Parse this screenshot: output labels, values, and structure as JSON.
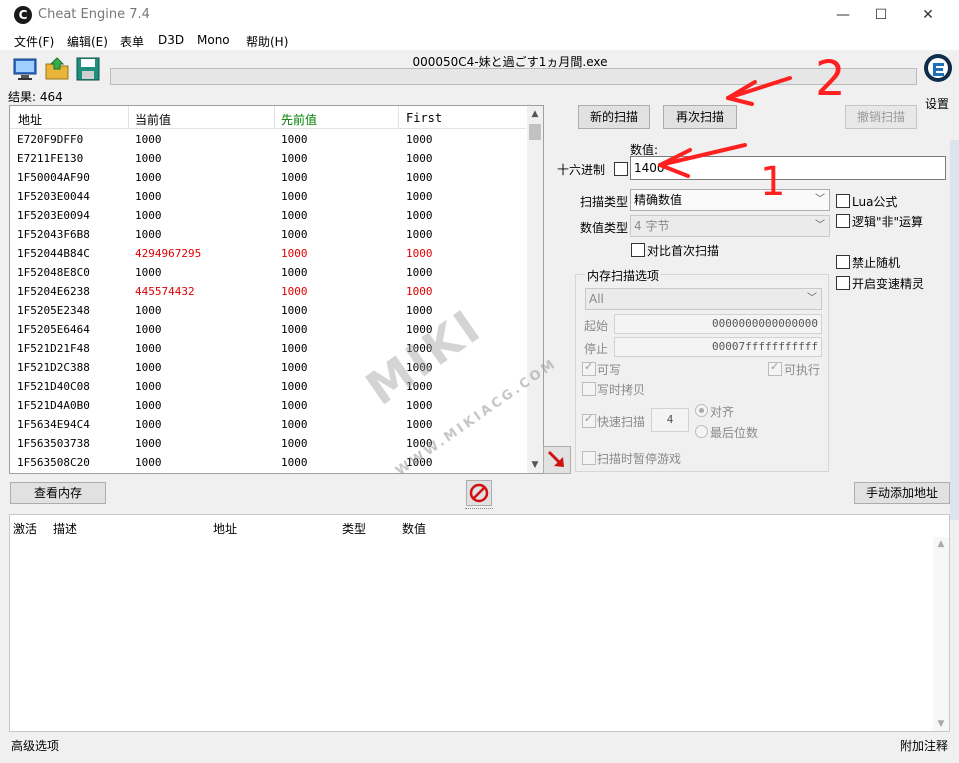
{
  "window": {
    "title": "Cheat Engine 7.4",
    "minimize_glyph": "—",
    "maximize_glyph": "☐",
    "close_glyph": "✕"
  },
  "menu": [
    "文件(F)",
    "编辑(E)",
    "表单",
    "D3D",
    "Mono",
    "帮助(H)"
  ],
  "process": {
    "name": "000050C4-妹と過ごす1ヵ月間.exe"
  },
  "settings_label": "设置",
  "results": {
    "label": "结果: 464"
  },
  "result_columns": [
    "地址",
    "当前值",
    "先前值",
    "First"
  ],
  "result_rows": [
    {
      "address": "E720F9DFF0",
      "current": "1000",
      "previous": "1000",
      "first": "1000",
      "changed": false
    },
    {
      "address": "E7211FE130",
      "current": "1000",
      "previous": "1000",
      "first": "1000",
      "changed": false
    },
    {
      "address": "1F50004AF90",
      "current": "1000",
      "previous": "1000",
      "first": "1000",
      "changed": false
    },
    {
      "address": "1F5203E0044",
      "current": "1000",
      "previous": "1000",
      "first": "1000",
      "changed": false
    },
    {
      "address": "1F5203E0094",
      "current": "1000",
      "previous": "1000",
      "first": "1000",
      "changed": false
    },
    {
      "address": "1F52043F6B8",
      "current": "1000",
      "previous": "1000",
      "first": "1000",
      "changed": false
    },
    {
      "address": "1F52044B84C",
      "current": "4294967295",
      "previous": "1000",
      "first": "1000",
      "changed": true
    },
    {
      "address": "1F52048E8C0",
      "current": "1000",
      "previous": "1000",
      "first": "1000",
      "changed": false
    },
    {
      "address": "1F5204E6238",
      "current": "445574432",
      "previous": "1000",
      "first": "1000",
      "changed": true
    },
    {
      "address": "1F5205E2348",
      "current": "1000",
      "previous": "1000",
      "first": "1000",
      "changed": false
    },
    {
      "address": "1F5205E6464",
      "current": "1000",
      "previous": "1000",
      "first": "1000",
      "changed": false
    },
    {
      "address": "1F521D21F48",
      "current": "1000",
      "previous": "1000",
      "first": "1000",
      "changed": false
    },
    {
      "address": "1F521D2C388",
      "current": "1000",
      "previous": "1000",
      "first": "1000",
      "changed": false
    },
    {
      "address": "1F521D40C08",
      "current": "1000",
      "previous": "1000",
      "first": "1000",
      "changed": false
    },
    {
      "address": "1F521D4A0B0",
      "current": "1000",
      "previous": "1000",
      "first": "1000",
      "changed": false
    },
    {
      "address": "1F5634E94C4",
      "current": "1000",
      "previous": "1000",
      "first": "1000",
      "changed": false
    },
    {
      "address": "1F563503738",
      "current": "1000",
      "previous": "1000",
      "first": "1000",
      "changed": false
    },
    {
      "address": "1F563508C20",
      "current": "1000",
      "previous": "1000",
      "first": "1000",
      "changed": false
    }
  ],
  "scan": {
    "new_scan": "新的扫描",
    "next_scan": "再次扫描",
    "undo_scan": "撤销扫描",
    "value_label": "数值:",
    "hex_label": "十六进制",
    "value": "1400",
    "scan_type_label": "扫描类型",
    "scan_type": "精确数值",
    "value_type_label": "数值类型",
    "value_type": "4 字节",
    "compare_first": "对比首次扫描",
    "lua_formula": "Lua公式",
    "logical_not": "逻辑\"非\"运算",
    "disable_random": "禁止随机",
    "speedhack": "开启变速精灵"
  },
  "mem_options": {
    "title": "内存扫描选项",
    "region": "All",
    "start_label": "起始",
    "start": "0000000000000000",
    "stop_label": "停止",
    "stop": "00007fffffffffff",
    "writable": "可写",
    "executable": "可执行",
    "copy_on_write": "写时拷贝",
    "fast_scan": "快速扫描",
    "fast_scan_value": "4",
    "align": "对齐",
    "last_digits": "最后位数",
    "pause_game": "扫描时暂停游戏"
  },
  "view_memory": "查看内存",
  "add_address": "手动添加地址",
  "address_columns": [
    "激活",
    "描述",
    "地址",
    "类型",
    "数值"
  ],
  "advanced": "高级选项",
  "table_extras": "附加注释",
  "annotations": {
    "arrow1": "1",
    "arrow2": "2"
  },
  "watermark": {
    "main": "MIKI",
    "sub": "WWW.MIKIACG.COM"
  },
  "colors": {
    "changed": "#e00000",
    "previous_header": "#008000",
    "annotation": "#ff2020"
  }
}
